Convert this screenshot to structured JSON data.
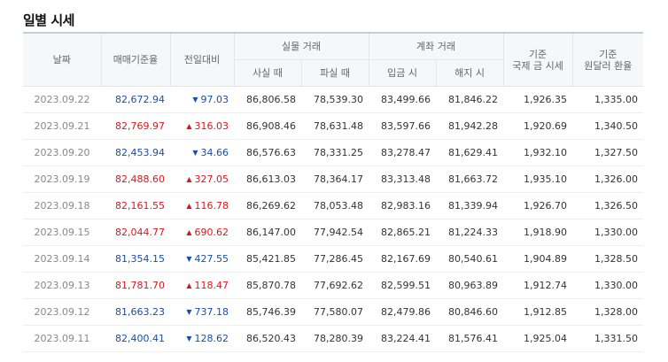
{
  "page": {
    "title": "일별 시세"
  },
  "table": {
    "headers": {
      "date": "날짜",
      "base_rate": "매매기준율",
      "change": "전일대비",
      "cash_group": "실물 거래",
      "cash_buy": "사실 때",
      "cash_sell": "파실 때",
      "transfer_group": "계좌 거래",
      "transfer_send": "입금 시",
      "transfer_receive": "해지 시",
      "intl_gold": "기준\n국제 금 시세",
      "usd_krw": "기준\n원달러 환율"
    },
    "rows": [
      {
        "date": "2023.09.22",
        "base": "82,672.94",
        "dir": "down",
        "arrow": "▼",
        "change": "97.03",
        "cash_buy": "86,806.58",
        "cash_sell": "78,539.30",
        "send": "83,499.66",
        "receive": "81,846.22",
        "gold": "1,926.35",
        "usd": "1,335.00"
      },
      {
        "date": "2023.09.21",
        "base": "82,769.97",
        "dir": "up",
        "arrow": "▲",
        "change": "316.03",
        "cash_buy": "86,908.46",
        "cash_sell": "78,631.48",
        "send": "83,597.66",
        "receive": "81,942.28",
        "gold": "1,920.69",
        "usd": "1,340.50"
      },
      {
        "date": "2023.09.20",
        "base": "82,453.94",
        "dir": "down",
        "arrow": "▼",
        "change": "34.66",
        "cash_buy": "86,576.63",
        "cash_sell": "78,331.25",
        "send": "83,278.47",
        "receive": "81,629.41",
        "gold": "1,932.10",
        "usd": "1,327.50"
      },
      {
        "date": "2023.09.19",
        "base": "82,488.60",
        "dir": "up",
        "arrow": "▲",
        "change": "327.05",
        "cash_buy": "86,613.03",
        "cash_sell": "78,364.17",
        "send": "83,313.48",
        "receive": "81,663.72",
        "gold": "1,935.10",
        "usd": "1,326.00"
      },
      {
        "date": "2023.09.18",
        "base": "82,161.55",
        "dir": "up",
        "arrow": "▲",
        "change": "116.78",
        "cash_buy": "86,269.62",
        "cash_sell": "78,053.48",
        "send": "82,983.16",
        "receive": "81,339.94",
        "gold": "1,926.70",
        "usd": "1,326.50"
      },
      {
        "date": "2023.09.15",
        "base": "82,044.77",
        "dir": "up",
        "arrow": "▲",
        "change": "690.62",
        "cash_buy": "86,147.00",
        "cash_sell": "77,942.54",
        "send": "82,865.21",
        "receive": "81,224.33",
        "gold": "1,918.90",
        "usd": "1,330.00"
      },
      {
        "date": "2023.09.14",
        "base": "81,354.15",
        "dir": "down",
        "arrow": "▼",
        "change": "427.55",
        "cash_buy": "85,421.85",
        "cash_sell": "77,286.45",
        "send": "82,167.69",
        "receive": "80,540.61",
        "gold": "1,904.89",
        "usd": "1,328.50"
      },
      {
        "date": "2023.09.13",
        "base": "81,781.70",
        "dir": "up",
        "arrow": "▲",
        "change": "118.47",
        "cash_buy": "85,870.78",
        "cash_sell": "77,692.62",
        "send": "82,599.51",
        "receive": "80,963.89",
        "gold": "1,912.74",
        "usd": "1,330.00"
      },
      {
        "date": "2023.09.12",
        "base": "81,663.23",
        "dir": "down",
        "arrow": "▼",
        "change": "737.18",
        "cash_buy": "85,746.39",
        "cash_sell": "77,580.07",
        "send": "82,479.86",
        "receive": "80,846.60",
        "gold": "1,912.85",
        "usd": "1,328.00"
      },
      {
        "date": "2023.09.11",
        "base": "82,400.41",
        "dir": "down",
        "arrow": "▼",
        "change": "128.62",
        "cash_buy": "86,520.43",
        "cash_sell": "78,280.39",
        "send": "83,224.41",
        "receive": "81,576.41",
        "gold": "1,925.04",
        "usd": "1,331.50"
      }
    ]
  },
  "colors": {
    "up": "#d7191c",
    "down": "#1a4ea8",
    "header_bg": "#f6f7f9"
  }
}
